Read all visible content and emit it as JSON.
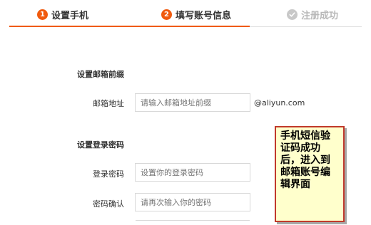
{
  "steps": [
    {
      "number": "1",
      "label": "设置手机"
    },
    {
      "number": "2",
      "label": "填写账号信息"
    },
    {
      "label": "注册成功"
    }
  ],
  "colors": {
    "accent": "#f05a0e",
    "note_border": "#c0392b",
    "note_background": "#ffffcc"
  },
  "form": {
    "email_section_title": "设置邮箱前缀",
    "email_label": "邮箱地址",
    "email_placeholder": "请输入邮箱地址前缀",
    "email_domain": "@aliyun.com",
    "password_section_title": "设置登录密码",
    "password_label": "登录密码",
    "password_placeholder": "设置你的登录密码",
    "confirm_label": "密码确认",
    "confirm_placeholder": "请再次输入你的密码"
  },
  "note": {
    "text": "手机短信验证码成功后，进入到邮箱账号编辑界面"
  },
  "icons": {
    "step3": "check-circle-icon"
  }
}
